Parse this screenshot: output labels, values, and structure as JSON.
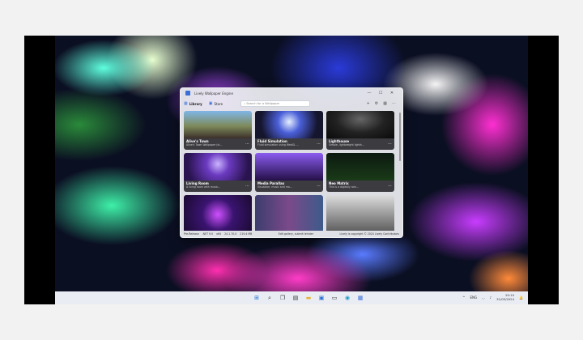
{
  "window": {
    "title": "Lively Wallpaper Engine",
    "controls": {
      "minimize": "—",
      "maximize": "☐",
      "close": "✕"
    },
    "tabs": [
      {
        "label": "Library",
        "icon": "library-icon"
      },
      {
        "label": "Store",
        "icon": "store-icon"
      }
    ],
    "search_placeholder": "Search for a Wallpaper",
    "tools": [
      "+",
      "⚙",
      "▦",
      "⋯"
    ]
  },
  "wallpapers": [
    {
      "name": "Alive's Town",
      "desc": "Alive's Town Wallpaper (st..."
    },
    {
      "name": "Fluid Simulation",
      "desc": "Fluid simulation using WebGL ..."
    },
    {
      "name": "Lighthouse",
      "desc": "Simple, lightweight lighth..."
    },
    {
      "name": "Living Room",
      "desc": "A living room with music..."
    },
    {
      "name": "Media Parallax",
      "desc": "Visualizer, music and mo..."
    },
    {
      "name": "Neo Matrix",
      "desc": "This is a digitally rain..."
    },
    {
      "name": "",
      "desc": ""
    },
    {
      "name": "",
      "desc": ""
    },
    {
      "name": "",
      "desc": ""
    }
  ],
  "status": {
    "left": [
      "Pre-Release",
      ".NET 9.0",
      "x64",
      "24.1.70.0",
      "219.4 MB"
    ],
    "middle": "Edit gallery, submit lehrder",
    "right": "Lively is copyright © 2024 Lively Contributors"
  },
  "taskbar": {
    "icons": [
      "start-icon",
      "search-icon",
      "task-view-icon",
      "widgets-icon",
      "file-explorer-icon",
      "store-icon",
      "terminal-icon",
      "edge-icon",
      "lively-icon"
    ],
    "tray": {
      "lang": "ENG",
      "time": "20:10",
      "date": "31/05/2024"
    }
  }
}
